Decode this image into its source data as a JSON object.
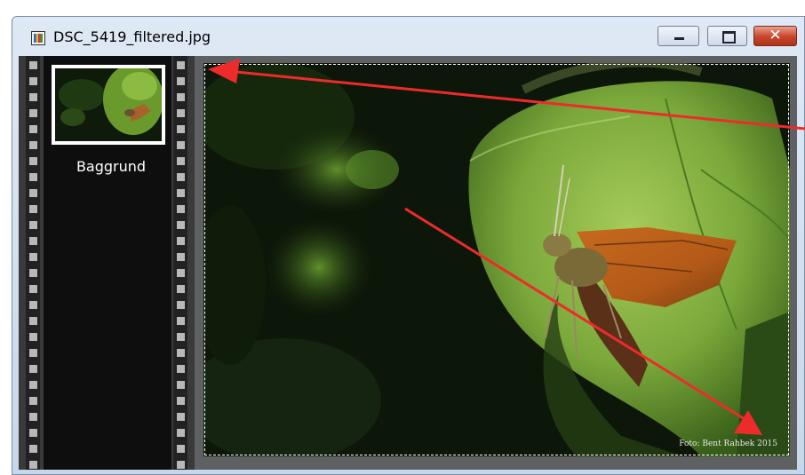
{
  "window": {
    "title": "DSC_5419_filtered.jpg",
    "icon": "image-file-icon",
    "controls": {
      "minimize": "minimize-icon",
      "maximize": "maximize-icon",
      "close": "✕"
    }
  },
  "filmstrip": {
    "layers": [
      {
        "label": "Baggrund"
      }
    ]
  },
  "photo": {
    "watermark": "Foto: Bent Rahbek 2015"
  },
  "annotations": {
    "arrow_color": "#ee2b2b"
  }
}
